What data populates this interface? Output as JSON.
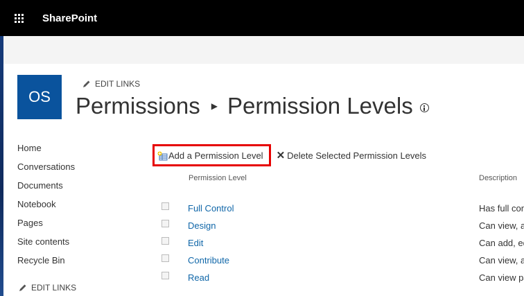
{
  "suite_bar": {
    "brand": "SharePoint",
    "app_launcher_icon": "waffle-icon"
  },
  "site": {
    "logo_text": "OS",
    "edit_links": "EDIT LINKS",
    "breadcrumb": [
      "Permissions",
      "Permission Levels"
    ]
  },
  "leftnav": {
    "items": [
      "Home",
      "Conversations",
      "Documents",
      "Notebook",
      "Pages",
      "Site contents",
      "Recycle Bin"
    ],
    "edit_links": "EDIT LINKS"
  },
  "toolbar": {
    "add_label": "Add a Permission Level",
    "delete_label": "Delete Selected Permission Levels",
    "highlight_color": "#e60000"
  },
  "table": {
    "columns": [
      "Permission Level",
      "Description"
    ],
    "rows": [
      {
        "name": "Full Control",
        "desc": "Has full contr"
      },
      {
        "name": "Design",
        "desc": "Can view, add"
      },
      {
        "name": "Edit",
        "desc": "Can add, edit"
      },
      {
        "name": "Contribute",
        "desc": "Can view, add"
      },
      {
        "name": "Read",
        "desc": "Can view pages"
      }
    ]
  }
}
